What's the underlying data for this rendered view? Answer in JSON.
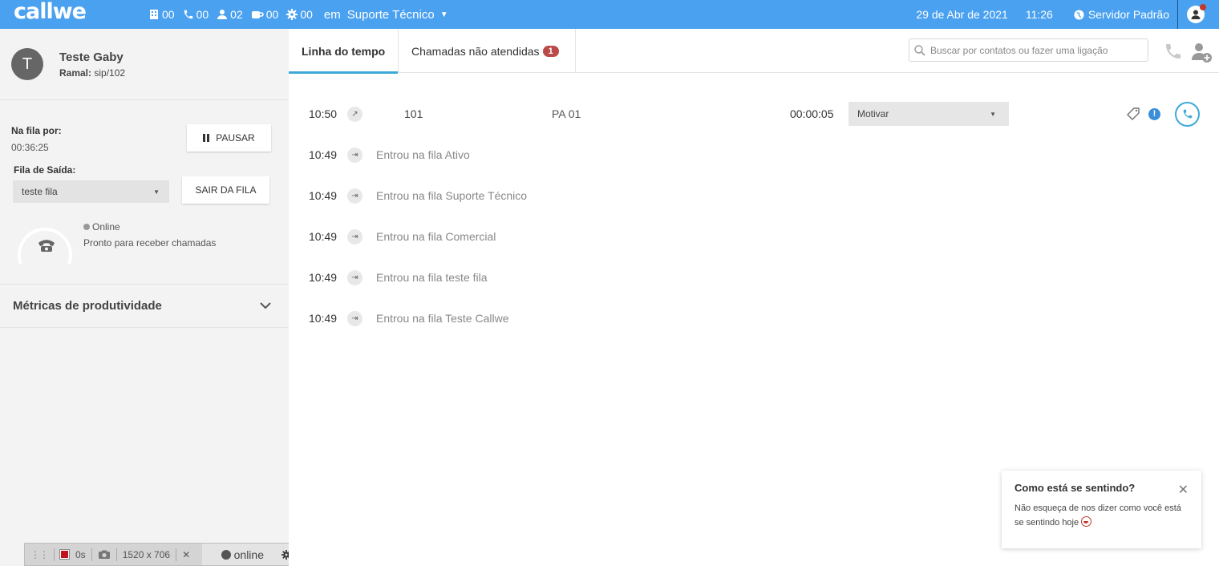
{
  "app": {
    "logo": "callwe"
  },
  "topbar": {
    "stats": [
      {
        "icon": "building-icon",
        "value": "00"
      },
      {
        "icon": "phone-icon",
        "value": "00"
      },
      {
        "icon": "user-icon",
        "value": "02"
      },
      {
        "icon": "coffee-icon",
        "value": "00"
      },
      {
        "icon": "gear-icon",
        "value": "00"
      }
    ],
    "em_label": "em",
    "queue": "Suporte Técnico",
    "date": "29 de Abr de 2021",
    "time": "11:26",
    "server": "Servidor Padrão"
  },
  "user": {
    "initial": "T",
    "name": "Teste Gaby",
    "ramal_label": "Ramal:",
    "ramal_value": "sip/102"
  },
  "queue_panel": {
    "time_label": "Na fila por:",
    "time_value": "00:36:25",
    "pause_label": "PAUSAR",
    "exit_label": "Fila de Saída:",
    "exit_selected": "teste fila",
    "exit_button": "SAIR DA FILA",
    "status": "Online",
    "status_desc": "Pronto para receber chamadas"
  },
  "metrics": {
    "label": "Métricas de produtividade"
  },
  "recorder": {
    "duration": "0s",
    "size": "1520 x 706",
    "status": "online"
  },
  "tabs": {
    "timeline": "Linha do tempo",
    "missed": "Chamadas não atendidas",
    "missed_count": "1"
  },
  "search": {
    "placeholder": "Buscar por contatos ou fazer uma ligação"
  },
  "timeline": {
    "call": {
      "time": "10:50",
      "number": "101",
      "pa": "PA 01",
      "duration": "00:00:05",
      "reason": "Motivar"
    },
    "events": [
      {
        "time": "10:49",
        "text": "Entrou na fila Ativo"
      },
      {
        "time": "10:49",
        "text": "Entrou na fila Suporte Técnico"
      },
      {
        "time": "10:49",
        "text": "Entrou na fila Comercial"
      },
      {
        "time": "10:49",
        "text": "Entrou na fila teste fila"
      },
      {
        "time": "10:49",
        "text": "Entrou na fila Teste Callwe"
      }
    ]
  },
  "toast": {
    "title": "Como está se sentindo?",
    "body": "Não esqueça de nos dizer como você está se sentindo hoje"
  },
  "colors": {
    "topbar": "#4aa1f0",
    "accent": "#3ea9d8",
    "badge": "#b94a48"
  }
}
